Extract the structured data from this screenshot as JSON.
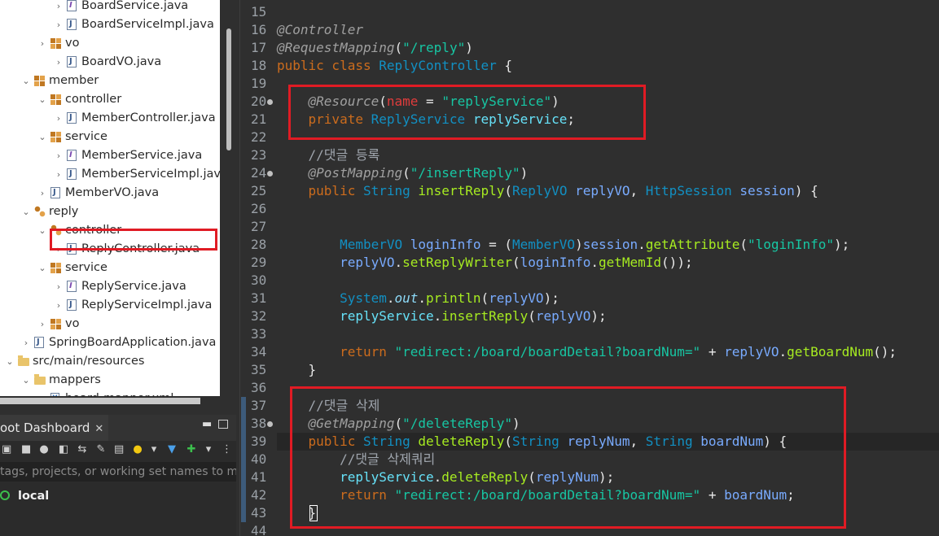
{
  "explorer": {
    "items": [
      {
        "label": "BoardService.java",
        "type": "iface",
        "indent": 3
      },
      {
        "label": "BoardServiceImpl.java",
        "type": "java",
        "indent": 3
      },
      {
        "label": "vo",
        "type": "pkg",
        "indent": 2
      },
      {
        "label": "BoardVO.java",
        "type": "java",
        "indent": 3
      },
      {
        "label": "member",
        "type": "pkg",
        "indent": 1
      },
      {
        "label": "controller",
        "type": "pkg",
        "indent": 2
      },
      {
        "label": "MemberController.java",
        "type": "java",
        "indent": 3
      },
      {
        "label": "service",
        "type": "pkg",
        "indent": 2
      },
      {
        "label": "MemberService.java",
        "type": "iface",
        "indent": 3
      },
      {
        "label": "MemberServiceImpl.java",
        "type": "java",
        "indent": 3
      },
      {
        "label": "MemberVO.java",
        "type": "java",
        "indent": 2
      },
      {
        "label": "reply",
        "type": "sub",
        "indent": 1
      },
      {
        "label": "controller",
        "type": "sub",
        "indent": 2
      },
      {
        "label": "ReplyController.java",
        "type": "java",
        "indent": 3
      },
      {
        "label": "service",
        "type": "pkg",
        "indent": 2
      },
      {
        "label": "ReplyService.java",
        "type": "iface",
        "indent": 3
      },
      {
        "label": "ReplyServiceImpl.java",
        "type": "java",
        "indent": 3
      },
      {
        "label": "vo",
        "type": "pkg",
        "indent": 2
      },
      {
        "label": "SpringBoardApplication.java",
        "type": "java",
        "indent": 1
      },
      {
        "label": "src/main/resources",
        "type": "folder",
        "indent": 0
      },
      {
        "label": "mappers",
        "type": "folder",
        "indent": 1
      },
      {
        "label": "board-mapper.xml",
        "type": "xml",
        "indent": 2
      }
    ]
  },
  "dashboard": {
    "tab_label": "oot Dashboard",
    "close_glyph": "✕",
    "filter_placeholder": "tags, projects, or working set names to m",
    "local_label": "local"
  },
  "editor": {
    "lines": [
      {
        "n": "15",
        "html": ""
      },
      {
        "n": "16",
        "html": "<span class=\"ann\">@Controller</span>"
      },
      {
        "n": "17",
        "html": "<span class=\"ann\">@RequestMapping</span><span class=\"plain\">(</span><span class=\"str\">\"/reply\"</span><span class=\"plain\">)</span>"
      },
      {
        "n": "18",
        "html": "<span class=\"kw\">public class </span><span class=\"cls\">ReplyController</span><span class=\"plain\"> {</span>"
      },
      {
        "n": "19",
        "html": ""
      },
      {
        "n": "20",
        "fold": true,
        "html": "    <span class=\"ann\">@Resource</span><span class=\"plain\">(</span><span class=\"attr\">name</span><span class=\"plain\"> = </span><span class=\"str\">\"replyService\"</span><span class=\"plain\">)</span>"
      },
      {
        "n": "21",
        "html": "    <span class=\"kw\">private </span><span class=\"cls\">ReplyService </span><span class=\"fld\">replyService</span><span class=\"plain\">;</span>"
      },
      {
        "n": "22",
        "html": ""
      },
      {
        "n": "23",
        "html": "    <span class=\"cmt\">//댓글 등록</span>"
      },
      {
        "n": "24",
        "fold": true,
        "html": "    <span class=\"ann\">@PostMapping</span><span class=\"plain\">(</span><span class=\"str\">\"/insertReply\"</span><span class=\"plain\">)</span>"
      },
      {
        "n": "25",
        "html": "    <span class=\"kw\">public </span><span class=\"cls\">String </span><span class=\"meth\">insertReply</span><span class=\"plain\">(</span><span class=\"cls\">ReplyVO </span><span class=\"var\">replyVO</span><span class=\"plain\">, </span><span class=\"cls\">HttpSession </span><span class=\"var\">session</span><span class=\"plain\">) {</span>"
      },
      {
        "n": "26",
        "html": ""
      },
      {
        "n": "27",
        "html": ""
      },
      {
        "n": "28",
        "html": "        <span class=\"cls\">MemberVO </span><span class=\"var\">loginInfo</span><span class=\"plain\"> = (</span><span class=\"cls\">MemberVO</span><span class=\"plain\">)</span><span class=\"var\">session</span><span class=\"plain\">.</span><span class=\"meth\">getAttribute</span><span class=\"plain\">(</span><span class=\"str\">\"loginInfo\"</span><span class=\"plain\">);</span>"
      },
      {
        "n": "29",
        "html": "        <span class=\"var\">replyVO</span><span class=\"plain\">.</span><span class=\"meth\">setReplyWriter</span><span class=\"plain\">(</span><span class=\"var\">loginInfo</span><span class=\"plain\">.</span><span class=\"meth\">getMemId</span><span class=\"plain\">());</span>"
      },
      {
        "n": "30",
        "html": ""
      },
      {
        "n": "31",
        "html": "        <span class=\"cls\">System</span><span class=\"plain\">.</span><span class=\"sfld\">out</span><span class=\"plain\">.</span><span class=\"meth\">println</span><span class=\"plain\">(</span><span class=\"var\">replyVO</span><span class=\"plain\">);</span>"
      },
      {
        "n": "32",
        "html": "        <span class=\"fld\">replyService</span><span class=\"plain\">.</span><span class=\"meth\">insertReply</span><span class=\"plain\">(</span><span class=\"var\">replyVO</span><span class=\"plain\">);</span>"
      },
      {
        "n": "33",
        "html": ""
      },
      {
        "n": "34",
        "html": "        <span class=\"kw\">return </span><span class=\"str\">\"redirect:/board/boardDetail?boardNum=\"</span><span class=\"plain\"> + </span><span class=\"var\">replyVO</span><span class=\"plain\">.</span><span class=\"meth\">getBoardNum</span><span class=\"plain\">();</span>"
      },
      {
        "n": "35",
        "html": "    <span class=\"plain\">}</span>"
      },
      {
        "n": "36",
        "html": ""
      },
      {
        "n": "37",
        "html": "    <span class=\"cmt\">//댓글 삭제</span>"
      },
      {
        "n": "38",
        "fold": true,
        "html": "    <span class=\"ann\">@GetMapping</span><span class=\"plain\">(</span><span class=\"str\">\"/deleteReply\"</span><span class=\"plain\">)</span>"
      },
      {
        "n": "39",
        "html": "    <span class=\"kw\">public </span><span class=\"cls\">String </span><span class=\"meth\">deleteReply</span><span class=\"plain\">(</span><span class=\"cls\">String </span><span class=\"var\">replyNum</span><span class=\"plain\">, </span><span class=\"cls\">String </span><span class=\"var\">boardNum</span><span class=\"plain\">) {</span>"
      },
      {
        "n": "40",
        "html": "        <span class=\"cmt\">//댓글 삭제쿼리</span>"
      },
      {
        "n": "41",
        "html": "        <span class=\"fld\">replyService</span><span class=\"plain\">.</span><span class=\"meth\">deleteReply</span><span class=\"plain\">(</span><span class=\"var\">replyNum</span><span class=\"plain\">);</span>"
      },
      {
        "n": "42",
        "html": "        <span class=\"kw\">return </span><span class=\"str\">\"redirect:/board/boardDetail?boardNum=\"</span><span class=\"plain\"> + </span><span class=\"var\">boardNum</span><span class=\"plain\">;</span>"
      },
      {
        "n": "43",
        "html": "    <span class=\"plain\">}</span>"
      },
      {
        "n": "44",
        "html": ""
      }
    ]
  }
}
